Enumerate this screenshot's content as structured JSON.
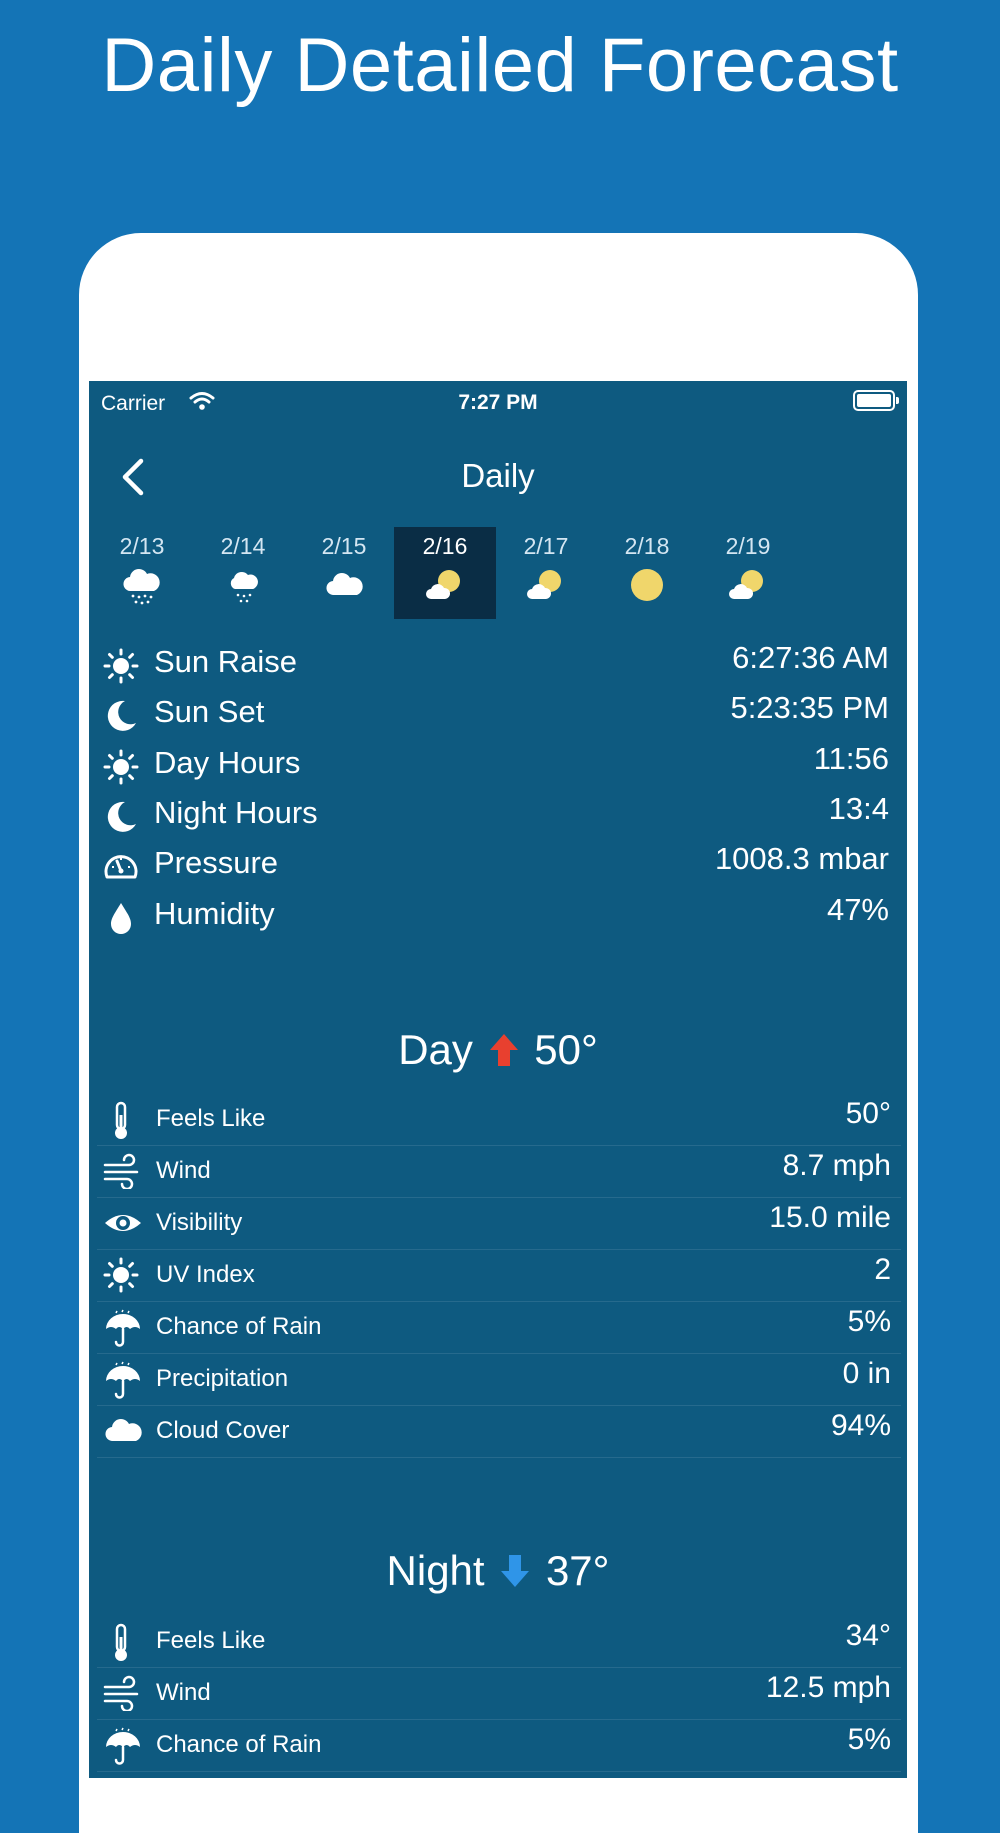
{
  "hero_title": "Daily Detailed Forecast",
  "status": {
    "carrier": "Carrier",
    "time": "7:27 PM"
  },
  "nav": {
    "title": "Daily"
  },
  "days": [
    {
      "date": "2/13",
      "icon": "cloud-snow-icon",
      "selected": false
    },
    {
      "date": "2/14",
      "icon": "cloud-snow-light-icon",
      "selected": false
    },
    {
      "date": "2/15",
      "icon": "cloud-icon",
      "selected": false
    },
    {
      "date": "2/16",
      "icon": "partly-cloudy-icon",
      "selected": true
    },
    {
      "date": "2/17",
      "icon": "partly-cloudy-icon",
      "selected": false
    },
    {
      "date": "2/18",
      "icon": "sun-icon",
      "selected": false
    },
    {
      "date": "2/19",
      "icon": "partly-cloudy-icon",
      "selected": false
    }
  ],
  "summary": [
    {
      "label": "Sun Raise",
      "value": "6:27:36 AM",
      "icon": "sun-icon"
    },
    {
      "label": "Sun Set",
      "value": "5:23:35 PM",
      "icon": "moon-icon"
    },
    {
      "label": "Day Hours",
      "value": "11:56",
      "icon": "sun-icon"
    },
    {
      "label": "Night Hours",
      "value": "13:4",
      "icon": "moon-icon"
    },
    {
      "label": "Pressure",
      "value": "1008.3 mbar",
      "icon": "gauge-icon"
    },
    {
      "label": "Humidity",
      "value": "47%",
      "icon": "drop-icon"
    }
  ],
  "day_section": {
    "label": "Day",
    "temp": "50°",
    "arrow_color": "#e8402f"
  },
  "day_rows": [
    {
      "label": "Feels Like",
      "value": "50°",
      "icon": "thermometer-icon"
    },
    {
      "label": "Wind",
      "value": "8.7 mph",
      "icon": "wind-icon"
    },
    {
      "label": "Visibility",
      "value": "15.0 mile",
      "icon": "eye-icon"
    },
    {
      "label": "UV Index",
      "value": "2",
      "icon": "sun-icon"
    },
    {
      "label": "Chance of Rain",
      "value": "5%",
      "icon": "umbrella-icon"
    },
    {
      "label": "Precipitation",
      "value": "0 in",
      "icon": "umbrella-icon"
    },
    {
      "label": "Cloud Cover",
      "value": "94%",
      "icon": "cloud-icon"
    }
  ],
  "night_section": {
    "label": "Night",
    "temp": "37°",
    "arrow_color": "#2f95e8"
  },
  "night_rows": [
    {
      "label": "Feels Like",
      "value": "34°",
      "icon": "thermometer-icon"
    },
    {
      "label": "Wind",
      "value": "12.5 mph",
      "icon": "wind-icon"
    },
    {
      "label": "Chance of Rain",
      "value": "5%",
      "icon": "umbrella-icon"
    }
  ],
  "colors": {
    "background": "#1474b6",
    "screen": "#0e5a80",
    "selected_day": "#0a2d45",
    "sun": "#f0d66b"
  }
}
